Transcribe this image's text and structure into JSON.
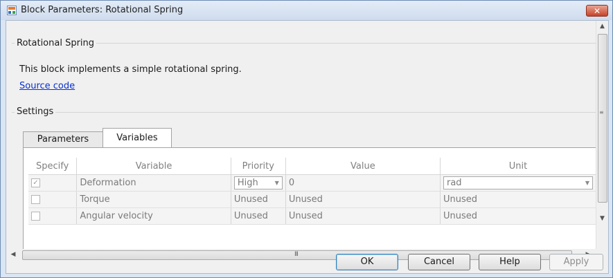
{
  "window": {
    "title": "Block Parameters: Rotational Spring",
    "close_glyph": "✕"
  },
  "block": {
    "group_title": "Rotational Spring",
    "description": "This block implements a simple rotational spring.",
    "source_link": "Source code"
  },
  "settings": {
    "group_title": "Settings",
    "tabs": [
      {
        "label": "Parameters",
        "active": false
      },
      {
        "label": "Variables",
        "active": true
      }
    ]
  },
  "variables_table": {
    "columns": [
      "Specify",
      "Variable",
      "Priority",
      "Value",
      "Unit"
    ],
    "rows": [
      {
        "specify": true,
        "variable": "Deformation",
        "priority": "High",
        "value": "0",
        "unit": "rad"
      },
      {
        "specify": false,
        "variable": "Torque",
        "priority": "Unused",
        "value": "Unused",
        "unit": "Unused"
      },
      {
        "specify": false,
        "variable": "Angular velocity",
        "priority": "Unused",
        "value": "Unused",
        "unit": "Unused"
      }
    ]
  },
  "icons": {
    "check": "✓",
    "dropdown": "▼",
    "up": "▲",
    "down": "▼",
    "left": "◀",
    "right": "▶",
    "grip_h": "III",
    "grip_v": "≡"
  },
  "buttons": {
    "ok": "OK",
    "cancel": "Cancel",
    "help": "Help",
    "apply": "Apply"
  },
  "colors": {
    "link": "#0a2fd0",
    "close": "#c7432a",
    "title_bar": "#dbe6f4"
  }
}
